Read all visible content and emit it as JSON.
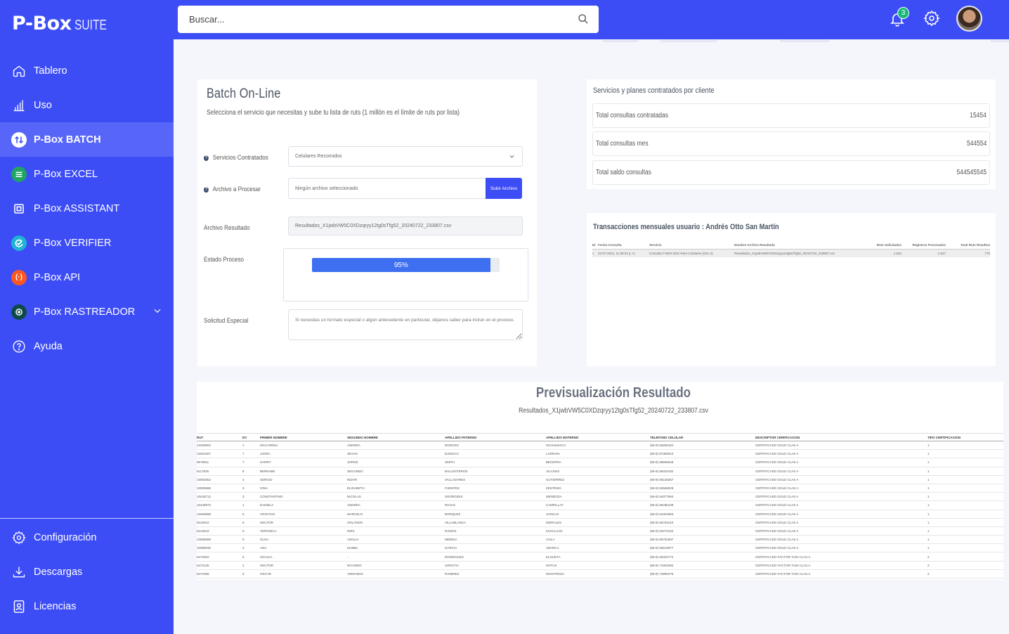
{
  "brand": {
    "logo_main": "P-Box",
    "logo_suffix": "SUITE"
  },
  "sidebar": {
    "items": [
      {
        "label": "Tablero",
        "icon": "home-icon"
      },
      {
        "label": "Uso",
        "icon": "bar-chart-icon"
      },
      {
        "label": "P-Box BATCH",
        "icon": "swap-arrows-icon",
        "active": true
      },
      {
        "label": "P-Box EXCEL",
        "icon": "excel-icon"
      },
      {
        "label": "P-Box ASSISTANT",
        "icon": "assistant-icon"
      },
      {
        "label": "P-Box VERIFIER",
        "icon": "verifier-icon"
      },
      {
        "label": "P-Box API",
        "icon": "api-icon"
      },
      {
        "label": "P-Box RASTREADOR",
        "icon": "radar-icon"
      },
      {
        "label": "Ayuda",
        "icon": "help-icon"
      }
    ],
    "bottom": [
      {
        "label": "Configuración",
        "icon": "gear-icon"
      },
      {
        "label": "Descargas",
        "icon": "download-icon"
      },
      {
        "label": "Licencias",
        "icon": "license-icon"
      }
    ]
  },
  "topbar": {
    "search_placeholder": "Buscar...",
    "notifications": "3"
  },
  "batch": {
    "title": "Batch On-Line",
    "subtitle": "Selecciona el servicio que necesitas y sube tu lista de ruts (1 millón es el límite de ruts por lista)",
    "services_label": "Servicios Contratados",
    "services_value": "Celulares Recomidos",
    "file_label": "Archivo a Procesar",
    "file_value": "Ningún archivo seleccionado",
    "upload_button": "Subir Archivo",
    "result_label": "Archivo Resultado",
    "result_value": "Resultados_X1jwbVW5C0XDzqryy12tg0sTfg52_20240722_233807.csv",
    "status_label": "Estado Proceso",
    "progress_text": "95%",
    "progress": 0.95,
    "special_label": "Solicitud Especial",
    "special_placeholder": "Si necesitas un formato especial o algún antecedente en particular, déjanos saber para incluir en el proceso."
  },
  "services": {
    "title": "Servicios y planes contratados por cliente",
    "rows": [
      {
        "label": "Total consultas contratadas",
        "value": "15454"
      },
      {
        "label": "Total consultas mes",
        "value": "544554"
      },
      {
        "label": "Total saldo consultas",
        "value": "544545545"
      }
    ]
  },
  "transactions": {
    "title": "Transacciones mensuales usuario : Andrés Otto San Martín",
    "headers": [
      "ID",
      "Fecha Consulta",
      "Servicio",
      "Nombre Archivo Resultado",
      "Ruts Solicitados",
      "Registros Procesados",
      "Total Ruts Resultos"
    ],
    "rows": [
      [
        "1",
        "22-07-2024, 11:38:24 p. m.",
        "Consulta P-BOX B2C-Ruts-Celulares (Gen 2)",
        "Resultados_X1jwbVW5C0XDzqryy12tg0sTfg52_20240722_233807.csv",
        "1.634",
        "1.527",
        "770"
      ]
    ]
  },
  "preview": {
    "title": "Previsualización Resultado",
    "filename": "Resultados_X1jwbVW5C0XDzqryy12tg0sTfg52_20240722_233807.csv",
    "headers": [
      "RUT",
      "DV",
      "PRIMER NOMBRE",
      "SEGUNDO NOMBRE",
      "APELLIDO PATERNO",
      "APELLIDO MATERNO",
      "TELEFONO CELULAR",
      "DESCRIPTOR CERIFICACION",
      "TIPO CERTIFICACION"
    ],
    "rows": [
      [
        "13409004",
        "1",
        "MACARENA",
        "ANDREA",
        "DONOSO",
        "SCHULBACH",
        "(56-9) 55265184",
        "CERTIFICADO GOLD CLAS A",
        "1"
      ],
      [
        "13401007",
        "7",
        "JADRA",
        "JEHAN",
        "DAMUCH",
        "LARRAIN",
        "(56-9) 97360010",
        "CERTIFICADO GOLD CLAS A",
        "1"
      ],
      [
        "9575811",
        "7",
        "HARRY",
        "JORGE",
        "SMITH",
        "BECERRA",
        "(56-9) 58659548",
        "CERTIFICADO GOLD CLAS A",
        "1"
      ],
      [
        "6117925",
        "8",
        "BERNABE",
        "SEGUNDO",
        "BALLESTEROS",
        "VILCHES",
        "(56-9) 56022432",
        "CERTIFICADO GOLD CLAS A",
        "1"
      ],
      [
        "10002553",
        "4",
        "SERGIO",
        "NIDAR",
        "VALLADARES",
        "GUTIERREZ",
        "(56-9) 68136367",
        "CERTIFICADO GOLD CLAS A",
        "1"
      ],
      [
        "10005686",
        "3",
        "GINA",
        "ELISABETH",
        "FUENTES",
        "ZENTENO",
        "(56-9) 84566528",
        "CERTIFICADO GOLD CLAS A",
        "1"
      ],
      [
        "10445713",
        "3",
        "CONSTANTINO",
        "NICOLAS",
        "GEORGIDIS",
        "MENDOZA",
        "(56-9) 64077694",
        "CERTIFICADO GOLD CLAS A",
        "1"
      ],
      [
        "10449973",
        "1",
        "DANIELA",
        "ANDREA",
        "ROJAS",
        "CAMPILLAY",
        "(56-9) 96495109",
        "CERTIFICADO GOLD CLAS A",
        "1"
      ],
      [
        "13460658",
        "K",
        "CRISTIAN",
        "MARCELO",
        "BORQUEZ",
        "VARGAS",
        "(56-9) 64301893",
        "CERTIFICADO GOLD CLAS A",
        "1"
      ],
      [
        "9120010",
        "8",
        "HECTOR",
        "ORLANDO",
        "VILLABLANCA",
        "MORALES",
        "(56-9) 65702210",
        "CERTIFICADO GOLD CLAS A",
        "1"
      ],
      [
        "6122643",
        "K",
        "VERONICA",
        "INES",
        "RAMOS",
        "KUKULJAN",
        "(56-9) 52272102",
        "CERTIFICADO GOLD CLAS A",
        "1"
      ],
      [
        "10096699",
        "K",
        "OLGA",
        "AMALIA",
        "MEDINA",
        "AVILA",
        "(56-9) 65791597",
        "CERTIFICADO GOLD CLAS A",
        "1"
      ],
      [
        "10096030",
        "3",
        "ANA",
        "ISABEL",
        "GARCIA",
        "ABARCA",
        "(56-9) 65619677",
        "CERTIFICADO GOLD CLAS A",
        "1"
      ],
      [
        "5474002",
        "6",
        "CECILIA",
        "-",
        "RODRIGUEZ",
        "ELGUETA",
        "(56-9) 65324772",
        "CERTIFICADO FACTOR TUSI CLAS A",
        "2"
      ],
      [
        "5474125",
        "4",
        "HECTOR",
        "RICARDO",
        "URRUTIA",
        "MATUS",
        "(56-9) 74302282",
        "CERTIFICADO FACTOR TUSI CLAS A",
        "2"
      ],
      [
        "5474365",
        "8",
        "OSCAR",
        "ARMANDO",
        "RAMIREZ",
        "INOSTROZA",
        "(56-9) 74890276",
        "CERTIFICADO FACTOR TUSI CLAS A",
        "2"
      ]
    ]
  },
  "colors": {
    "brand": "#3d4df6",
    "active_nav": "#5766f8",
    "progress": "#3d6ff0",
    "badge": "#18b87a"
  }
}
